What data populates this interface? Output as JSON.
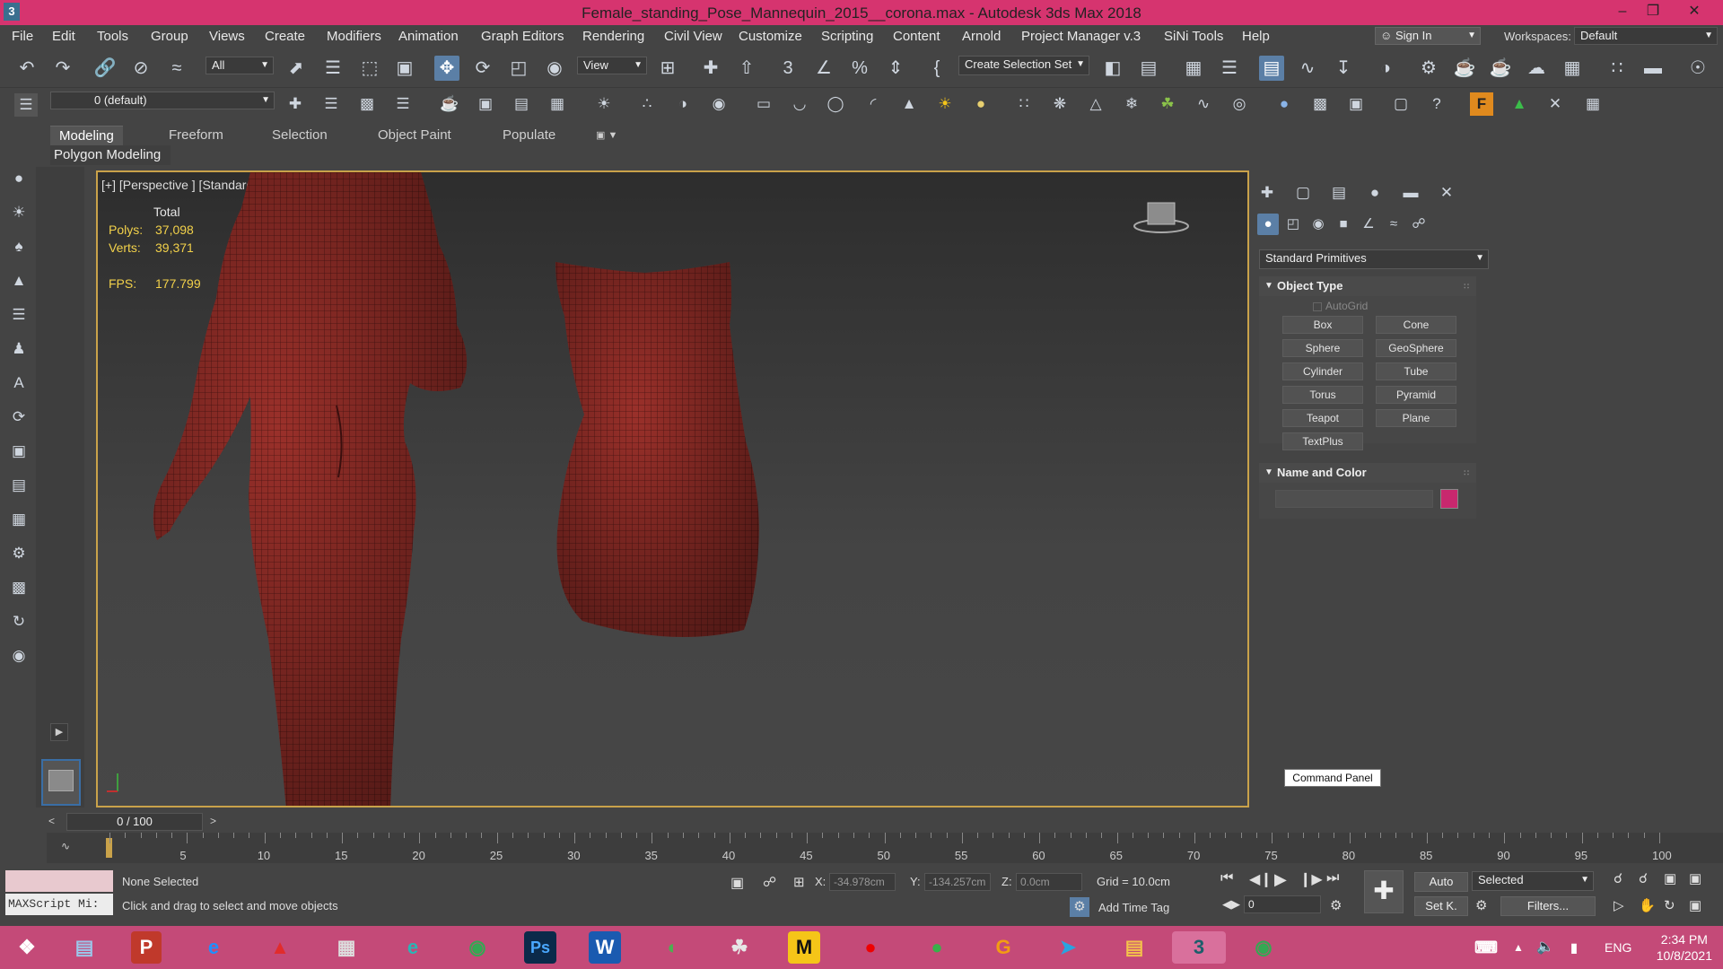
{
  "window": {
    "title": "Female_standing_Pose_Mannequin_2015__corona.max - Autodesk 3ds Max 2018",
    "app_icon": "3"
  },
  "menu": [
    "File",
    "Edit",
    "Tools",
    "Group",
    "Views",
    "Create",
    "Modifiers",
    "Animation",
    "Graph Editors",
    "Rendering",
    "Civil View",
    "Customize",
    "Scripting",
    "Content",
    "Arnold",
    "Project Manager v.3",
    "SiNi Tools",
    "Help"
  ],
  "account": {
    "sign_in": "Sign In",
    "workspaces_label": "Workspaces:",
    "workspace": "Default"
  },
  "toolbar": {
    "filter": "All",
    "ref_coord": "View",
    "selection_set": "Create Selection Set",
    "layer": "0 (default)"
  },
  "ribbon": {
    "tabs": [
      "Modeling",
      "Freeform",
      "Selection",
      "Object Paint",
      "Populate"
    ],
    "active_tab": "Modeling",
    "sub": "Polygon Modeling"
  },
  "viewport": {
    "label": "[+] [Perspective ] [Standard ] [Clay + Edged Faces ]",
    "stats_header": "Total",
    "polys_label": "Polys:",
    "polys": "37,098",
    "verts_label": "Verts:",
    "verts": "39,371",
    "fps_label": "FPS:",
    "fps": "177.799",
    "mesh_color": "#8f2a26"
  },
  "command_panel": {
    "category": "Standard Primitives",
    "object_type_title": "Object Type",
    "autogrid": "AutoGrid",
    "buttons": [
      "Box",
      "Cone",
      "Sphere",
      "GeoSphere",
      "Cylinder",
      "Tube",
      "Torus",
      "Pyramid",
      "Teapot",
      "Plane",
      "TextPlus"
    ],
    "name_color_title": "Name and Color",
    "swatch_color": "#c8286e",
    "tooltip": "Command Panel"
  },
  "timeline": {
    "frame": "0 / 100",
    "ticks": [
      "5",
      "10",
      "15",
      "20",
      "25",
      "30",
      "35",
      "40",
      "45",
      "50",
      "55",
      "60",
      "65",
      "70",
      "75",
      "80",
      "85",
      "90",
      "95",
      "100"
    ]
  },
  "status": {
    "selection": "None Selected",
    "hint": "Click and drag to select and move objects",
    "maxscript": "MAXScript Mi:",
    "x_label": "X:",
    "x": "-34.978cm",
    "y_label": "Y:",
    "y": "-134.257cm",
    "z_label": "Z:",
    "z": "0.0cm",
    "grid": "Grid = 10.0cm",
    "add_time_tag": "Add Time Tag",
    "auto": "Auto",
    "selected": "Selected",
    "set_key": "Set K.",
    "filters": "Filters...",
    "frame_field": "0"
  },
  "taskbar": {
    "lang": "ENG",
    "time": "2:34 PM",
    "date": "10/8/2021"
  }
}
